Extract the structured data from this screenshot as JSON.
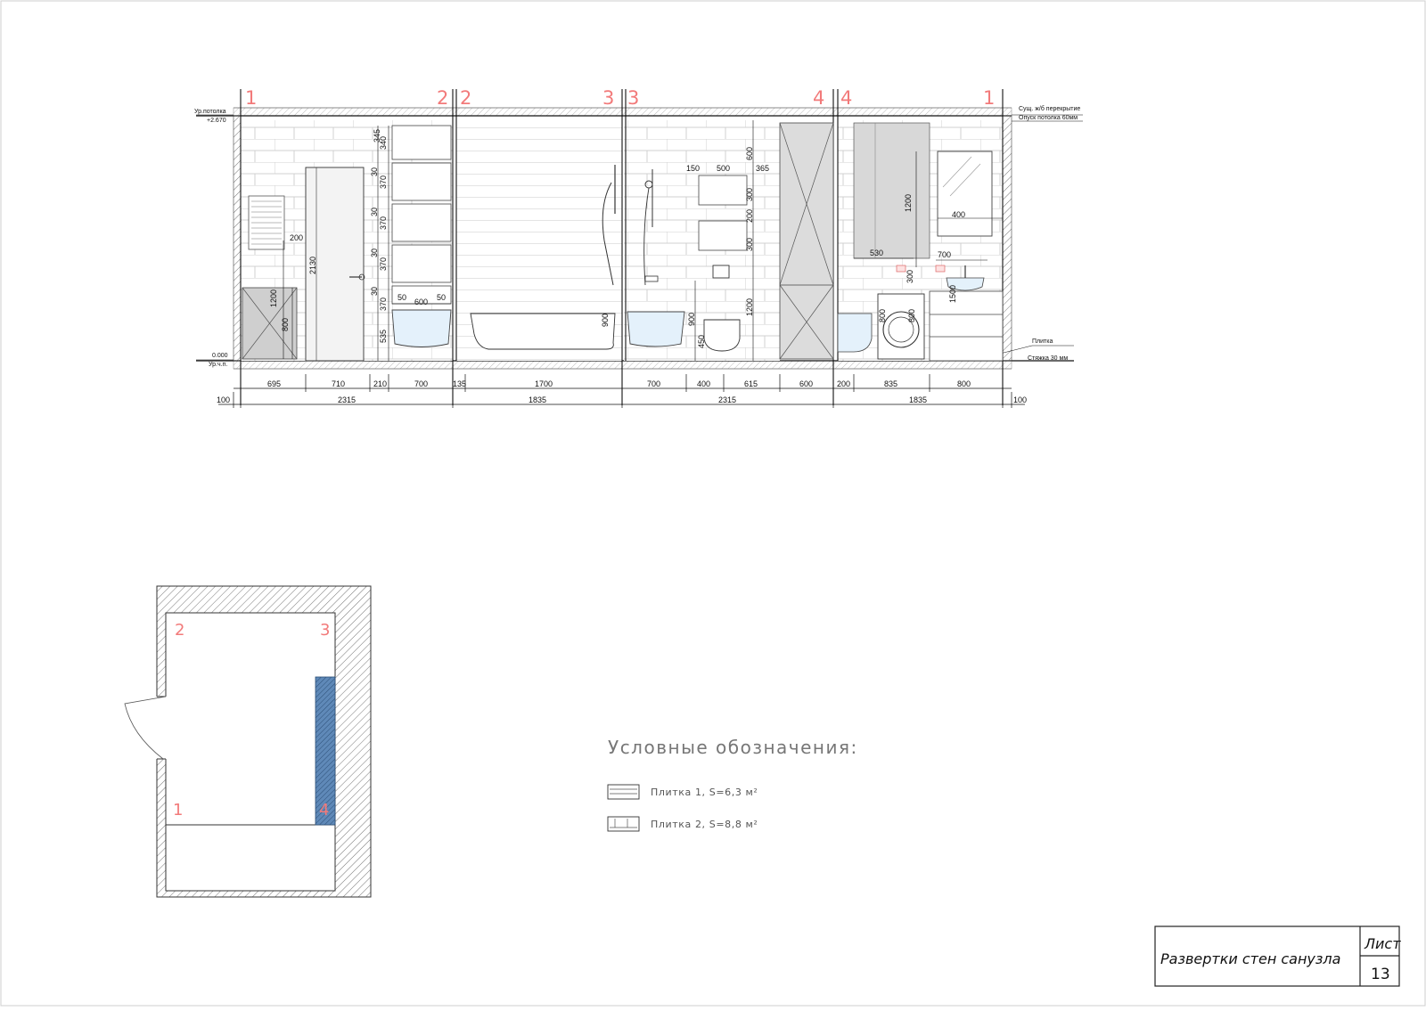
{
  "elevation": {
    "wall_numbers": [
      "1",
      "2",
      "2",
      "3",
      "3",
      "4",
      "4",
      "1"
    ],
    "level_labels": {
      "ceiling": "Ур.потолка",
      "ceiling_value": "+2.670",
      "floor_value": "0.000",
      "floor": "Ур.ч.п."
    },
    "annotations": {
      "slab": "Сущ. ж/б перекрытие",
      "ceiling_drop": "Опуск потолка 60мм",
      "tile": "Плитка",
      "screed": "Стяжка 30 мм"
    },
    "bottom_dims_row1": [
      "695",
      "710",
      "210",
      "700",
      "135",
      "1700",
      "700",
      "400",
      "615",
      "600",
      "200",
      "835",
      "800"
    ],
    "bottom_dims_row2": [
      "100",
      "2315",
      "1835",
      "2315",
      "1835",
      "100"
    ],
    "wall1_dims": {
      "heater": "200",
      "heater_height": "1200",
      "cabinet": "800",
      "door_height": "2130"
    },
    "shelf_dims": [
      "345",
      "340",
      "30",
      "370",
      "30",
      "370",
      "30",
      "370",
      "30",
      "370",
      "535"
    ],
    "tub_dims": [
      "50",
      "600",
      "50"
    ],
    "wall2_dims": {
      "tub_height": "900"
    },
    "wall3_dims": {
      "a": "150",
      "b": "500",
      "c": "600",
      "d": "365",
      "e": "300",
      "f": "200",
      "g": "300",
      "h": "1200",
      "i": "900",
      "j": "450"
    },
    "wall4_dims": {
      "a": "1200",
      "b": "400",
      "c": "700",
      "d": "530",
      "e": "300",
      "f": "1500",
      "g": "800",
      "h": "800"
    }
  },
  "plan": {
    "numbers": [
      "2",
      "3",
      "1",
      "4"
    ]
  },
  "legend": {
    "title": "Условные обозначения:",
    "items": [
      {
        "label": "Плитка 1, S=6,3 м²"
      },
      {
        "label": "Плитка 2, S=8,8 м²"
      }
    ]
  },
  "title_block": {
    "title": "Развертки стен санузла",
    "sheet_label": "Лист",
    "sheet_number": "13"
  },
  "colors": {
    "wall_number": "#f27a7a",
    "accent_blue": "#5f89b8",
    "fixture_blue": "#e4f1fb",
    "panel_gray": "#d8d8d8"
  }
}
